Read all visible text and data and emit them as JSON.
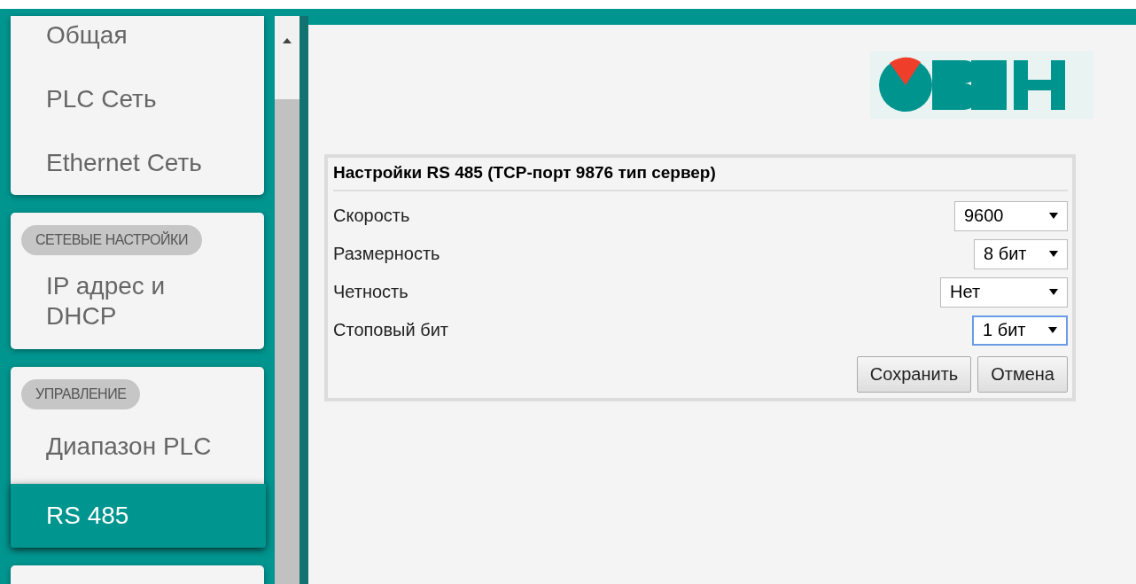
{
  "sidebar": {
    "groups": [
      {
        "items": [
          {
            "label": "Общая",
            "selected": false
          },
          {
            "label": "PLC Сеть",
            "selected": false
          },
          {
            "label": "Ethernet Сеть",
            "selected": false
          }
        ]
      },
      {
        "badge": "СЕТЕВЫЕ НАСТРОЙКИ",
        "items": [
          {
            "label": "IP адрес и DHCP",
            "selected": false
          }
        ]
      },
      {
        "badge": "УПРАВЛЕНИЕ",
        "items": [
          {
            "label": "Диапазон PLC",
            "selected": false
          },
          {
            "label": "RS 485",
            "selected": true
          }
        ]
      }
    ]
  },
  "form": {
    "title": "Настройки RS 485 (TCP-порт 9876 тип сервер)",
    "fields": [
      {
        "label": "Скорость",
        "value": "9600",
        "focused": false
      },
      {
        "label": "Размерность",
        "value": "8 бит",
        "focused": false
      },
      {
        "label": "Четность",
        "value": "Нет",
        "focused": false
      },
      {
        "label": "Стоповый бит",
        "value": "1 бит",
        "focused": true
      }
    ],
    "buttons": [
      "Сохранить",
      "Отмена"
    ]
  }
}
